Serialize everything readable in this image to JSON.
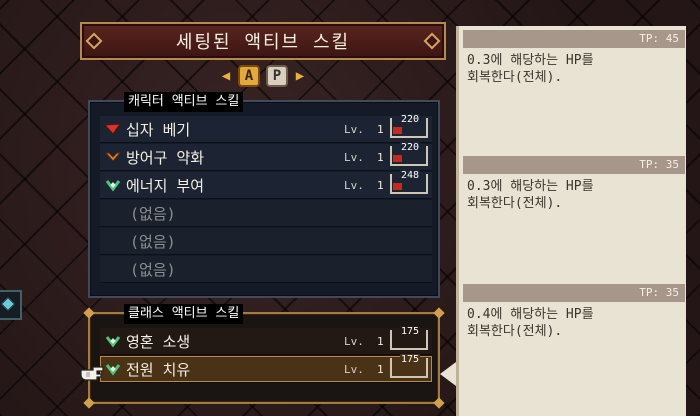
{
  "title": "세팅된 액티브 스킬",
  "tabs": {
    "active": "A",
    "passive": "P"
  },
  "character_panel": {
    "label": "캐릭터 액티브 스킬",
    "skills": [
      {
        "name": "십자 베기",
        "lv_label": "Lv.",
        "lv": "1",
        "tp": "220",
        "icon": "red-slash-icon",
        "icon_color": "#d8352a"
      },
      {
        "name": "방어구 약화",
        "lv_label": "Lv.",
        "lv": "1",
        "tp": "220",
        "icon": "orange-chevron-icon",
        "icon_color": "#e0852c"
      },
      {
        "name": "에너지 부여",
        "lv_label": "Lv.",
        "lv": "1",
        "tp": "248",
        "icon": "green-heal-icon",
        "icon_color": "#4fc47a"
      },
      {
        "name": "(없음)"
      },
      {
        "name": "(없음)"
      },
      {
        "name": "(없음)"
      }
    ]
  },
  "class_panel": {
    "label": "클래스 액티브 스킬",
    "skills": [
      {
        "name": "영혼 소생",
        "lv_label": "Lv.",
        "lv": "1",
        "tp": "175",
        "icon": "green-heal-icon",
        "icon_color": "#4fc47a"
      },
      {
        "name": "전원 치유",
        "lv_label": "Lv.",
        "lv": "1",
        "tp": "175",
        "icon": "green-heal-icon",
        "icon_color": "#4fc47a",
        "selected": true
      }
    ]
  },
  "descriptions": [
    {
      "tp": "TP: 45",
      "text": "0.3에 해당하는 HP를\n회복한다(전체)."
    },
    {
      "tp": "TP: 35",
      "text": "0.3에 해당하는 HP를\n회복한다(전체)."
    },
    {
      "tp": "TP: 35",
      "text": "0.4에 해당하는 HP를\n회복한다(전체)."
    }
  ],
  "colors": {
    "accent": "#e5a83a",
    "tp_fill": "#c5291e",
    "panel_border_gold": "#a47a3e"
  }
}
